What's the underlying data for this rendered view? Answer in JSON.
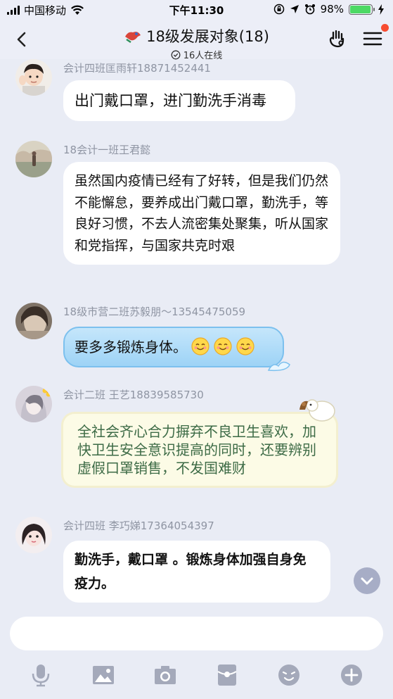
{
  "status_bar": {
    "carrier": "中国移动",
    "time": "下午11:30",
    "battery_percent": "98%",
    "battery_level": 0.98
  },
  "nav": {
    "title": "18级发展对象(18)",
    "online": "16人在线"
  },
  "messages": [
    {
      "sender": "会计四班匡雨轩18871452441",
      "text": "出门戴口罩，进门勤洗手消毒"
    },
    {
      "sender": "18会计一班王君懿",
      "text": "虽然国内疫情已经有了好转，但是我们仍然不能懈怠，要养成出门戴口罩，勤洗手，等良好习惯，不去人流密集处聚集，听从国家和党指挥，与国家共克时艰"
    },
    {
      "sender": "18级市营二班苏毅朋～13545475059",
      "text": "要多多锻炼身体。"
    },
    {
      "sender": "会计二班 王艺18839585730",
      "text": "全社会齐心合力摒弃不良卫生喜欢，加快卫生安全意识提高的同时，还要辨别虚假口罩销售，不发国难财"
    },
    {
      "sender": "会计四班 李巧娣17364054397",
      "text": "勤洗手，戴口罩 。锻炼身体加强自身免疫力。"
    }
  ],
  "input": {
    "placeholder": ""
  },
  "toolbar": [
    "microphone-icon",
    "image-icon",
    "camera-icon",
    "red-packet-icon",
    "emoji-icon",
    "plus-icon"
  ],
  "colors": {
    "accent": "#12b7f5",
    "background": "#e9ecf5",
    "red_dot": "#f74c31",
    "sender_gray": "#8f95a3"
  }
}
